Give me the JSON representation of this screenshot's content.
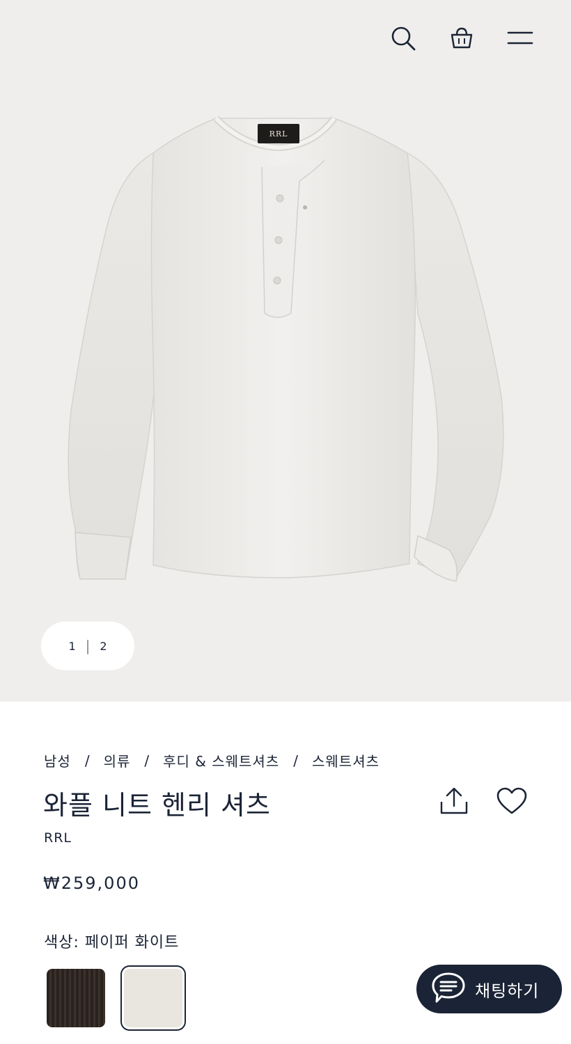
{
  "header": {
    "search_icon": "search-icon",
    "bag_icon": "shopping-bag-icon",
    "menu_icon": "hamburger-menu-icon"
  },
  "gallery": {
    "current_page": "1",
    "separator": "|",
    "total_pages": "2",
    "label_lettering": "RRL"
  },
  "breadcrumb": {
    "items": [
      "남성",
      "의류",
      "후디 & 스웨트셔츠",
      "스웨트셔츠"
    ],
    "separator": "/"
  },
  "product": {
    "title": "와플 니트 헨리 셔츠",
    "brand": "RRL",
    "price": "₩259,000",
    "color_label": "색상: 페이퍼 화이트",
    "share_icon": "share-icon",
    "wishlist_icon": "heart-icon",
    "swatches": [
      {
        "name": "black",
        "color": "#2e2622",
        "selected": false
      },
      {
        "name": "paper-white",
        "color": "#e9e5df",
        "selected": true
      }
    ]
  },
  "chat": {
    "label": "채팅하기",
    "icon": "chat-bubble-icon"
  },
  "colors": {
    "navy": "#1b2436",
    "hero_background": "#efeeec"
  }
}
